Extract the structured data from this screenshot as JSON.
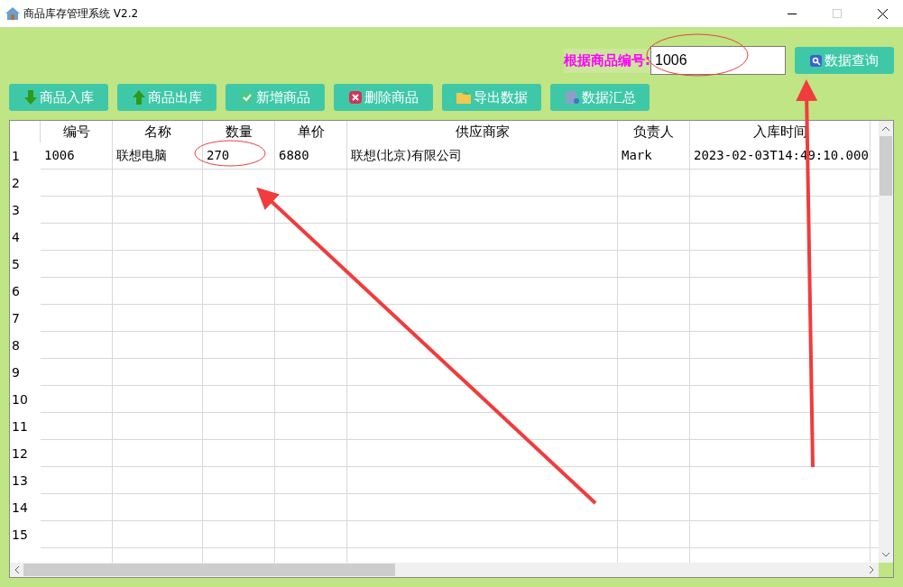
{
  "window": {
    "title": "商品库存管理系统 V2.2"
  },
  "search": {
    "label": "根据商品编号:",
    "value": "1006",
    "button": "数据查询"
  },
  "toolbar": [
    {
      "label": "商品入库",
      "kind": "in"
    },
    {
      "label": "商品出库",
      "kind": "out"
    },
    {
      "label": "新增商品",
      "kind": "add"
    },
    {
      "label": "删除商品",
      "kind": "delete"
    },
    {
      "label": "导出数据",
      "kind": "export"
    },
    {
      "label": "数据汇总",
      "kind": "summary"
    }
  ],
  "table": {
    "columns": [
      "编号",
      "名称",
      "数量",
      "单价",
      "供应商家",
      "负责人",
      "入库时间"
    ],
    "rows": [
      {
        "index": "1",
        "cells": [
          "1006",
          "联想电脑",
          "270",
          "6880",
          "联想(北京)有限公司",
          "Mark",
          "2023-02-03T14:49:10.000"
        ]
      },
      {
        "index": "2"
      },
      {
        "index": "3"
      },
      {
        "index": "4"
      },
      {
        "index": "5"
      },
      {
        "index": "6"
      },
      {
        "index": "7"
      },
      {
        "index": "8"
      },
      {
        "index": "9"
      },
      {
        "index": "10"
      },
      {
        "index": "11"
      },
      {
        "index": "12"
      },
      {
        "index": "13"
      },
      {
        "index": "14"
      },
      {
        "index": "15"
      }
    ]
  }
}
